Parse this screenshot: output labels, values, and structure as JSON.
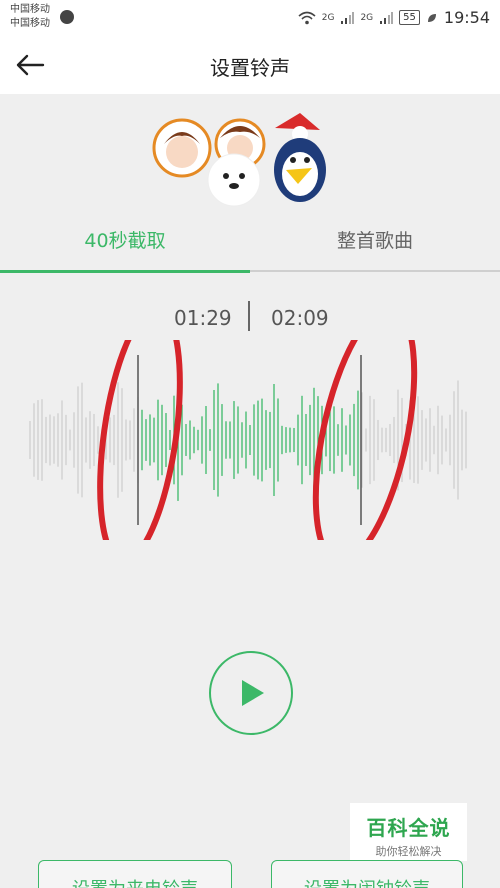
{
  "status_bar": {
    "carrier_1": "中国移动",
    "carrier_2": "中国移动",
    "signal_1": "2G",
    "signal_2": "2G",
    "battery": "55",
    "time": "19:54"
  },
  "header": {
    "title": "设置铃声"
  },
  "tabs": [
    {
      "label": "40秒截取",
      "active": true
    },
    {
      "label": "整首歌曲",
      "active": false
    }
  ],
  "clip": {
    "start": "01:29",
    "end": "02:09"
  },
  "watermark": {
    "title": "百科全说",
    "subtitle": "助你轻松解决"
  },
  "actions": {
    "ringtone": "设置为来电铃声",
    "alarm": "设置为闹钟铃声"
  },
  "colors": {
    "accent": "#3cb868",
    "annotation": "#d6242a"
  }
}
